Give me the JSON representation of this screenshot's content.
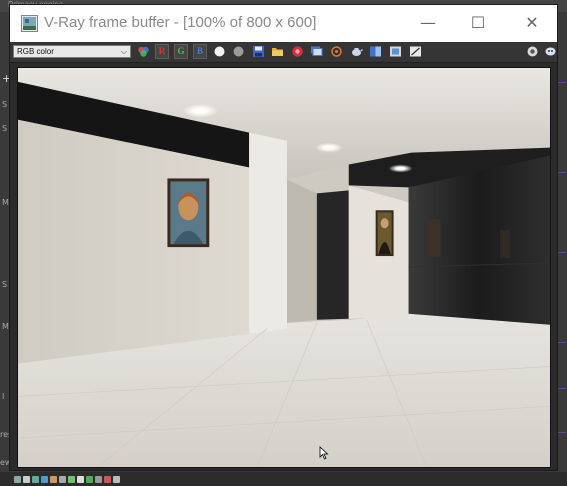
{
  "window": {
    "title": "V-Ray frame buffer - [100% of 800 x 600]",
    "minimize_glyph": "—",
    "maximize_glyph": "☐",
    "close_glyph": "✕"
  },
  "toolbar": {
    "channel_select": "RGB color",
    "red_label": "R",
    "green_label": "G",
    "blue_label": "B",
    "colors": {
      "red": "#e03030",
      "green": "#40c040",
      "blue": "#4a7ae0"
    }
  },
  "background_app": {
    "top_text": "Primacy engine",
    "left_markers": [
      "+",
      "S",
      "S",
      "M",
      "S",
      "M",
      "I",
      "rese",
      "ewz"
    ]
  },
  "icons": [
    "vray-app-icon",
    "color-wheel-icon",
    "mono-white-icon",
    "mono-gray-icon",
    "save-icon",
    "open-folder-icon",
    "stop-render-icon",
    "region-render-icon",
    "track-mouse-icon",
    "teapot-render-icon",
    "compare-icon",
    "pixel-info-icon",
    "color-correct-icon",
    "lens-effects-icon",
    "options-icon",
    "mouse-cursor-icon"
  ]
}
